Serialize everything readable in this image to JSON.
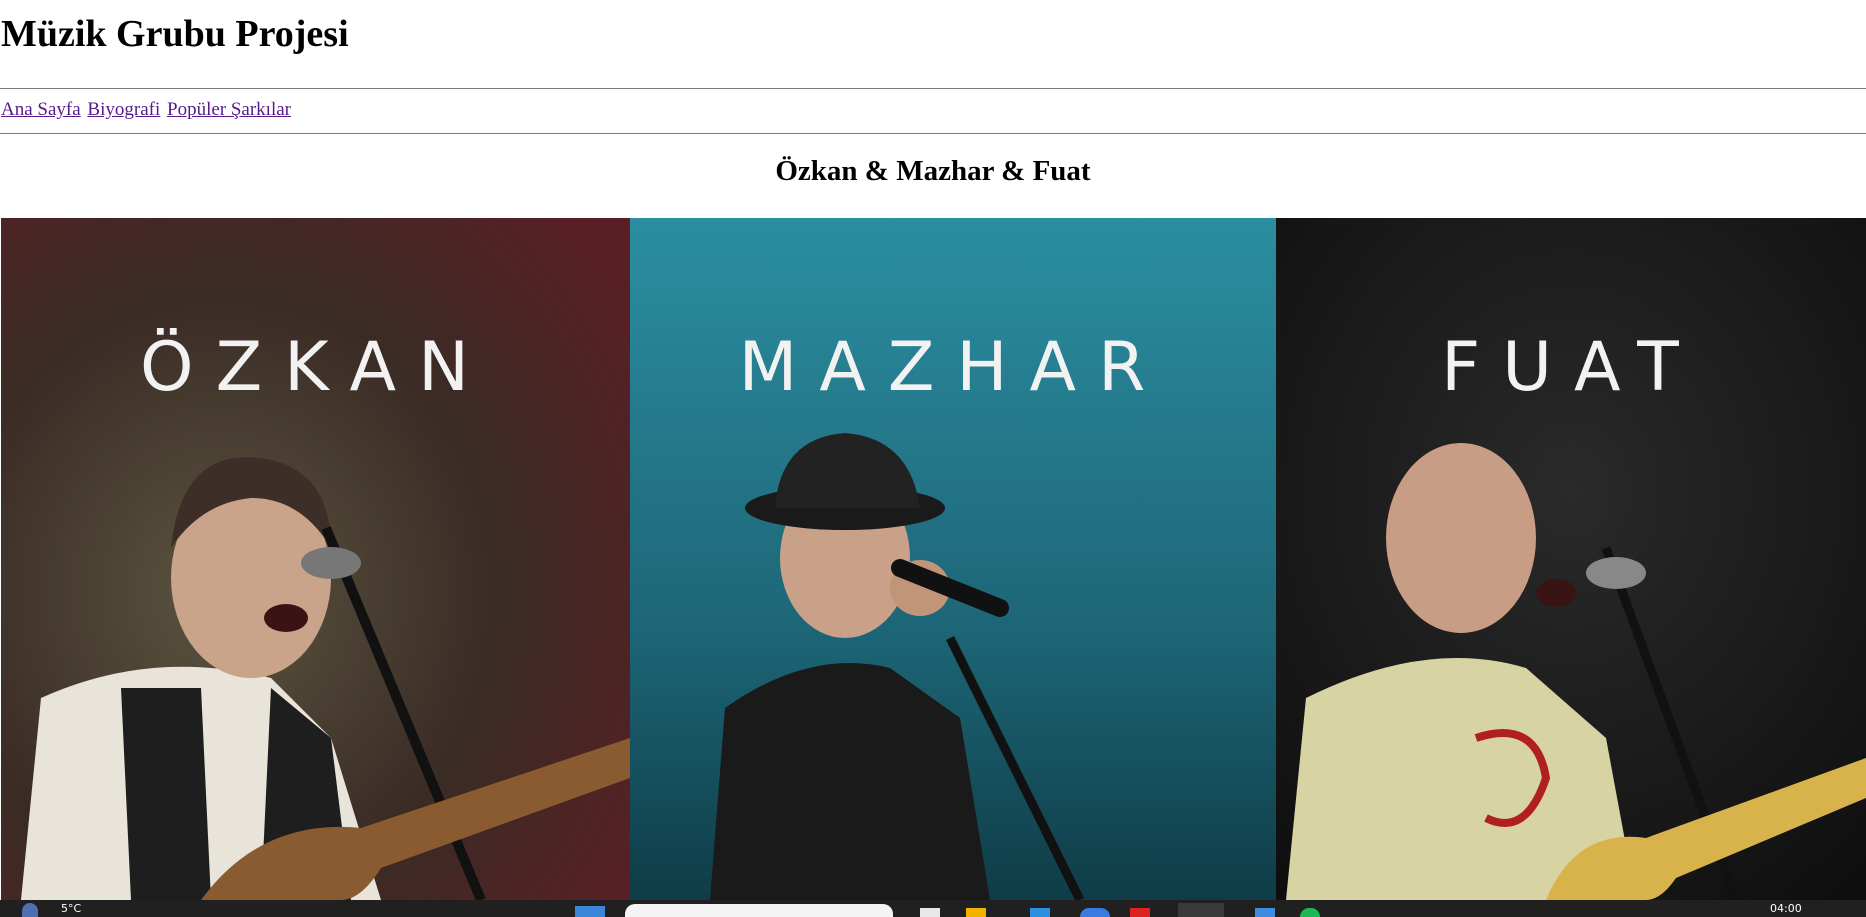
{
  "header": {
    "site_title": "Müzik Grubu Projesi"
  },
  "nav": {
    "items": [
      {
        "label": "Ana Sayfa"
      },
      {
        "label": "Biyografi"
      },
      {
        "label": "Popüler Şarkılar"
      }
    ]
  },
  "main": {
    "band_title": "Özkan & Mazhar & Fuat",
    "photo": {
      "panels": [
        {
          "name": "ÖZKAN",
          "bg_color": "#4a2a22"
        },
        {
          "name": "MAZHAR",
          "bg_color": "#1f6f7e"
        },
        {
          "name": "FUAT",
          "bg_color": "#171717"
        }
      ]
    }
  },
  "taskbar": {
    "weather": "5°C",
    "clock": "04:00"
  }
}
